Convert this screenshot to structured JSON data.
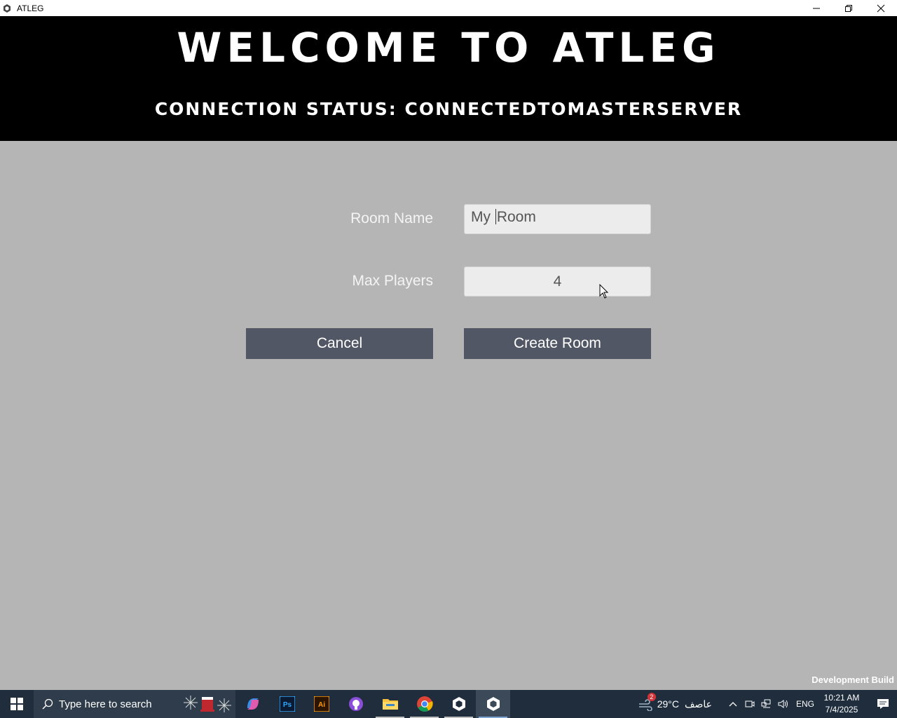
{
  "window": {
    "title": "ATLEG",
    "app_icon": "unity-icon",
    "controls": [
      "minimize-icon",
      "restore-icon",
      "close-icon"
    ]
  },
  "banner": {
    "welcome": "WELCOME TO ATLEG",
    "status": "CONNECTION STATUS: CONNECTEDTOMASTERSERVER"
  },
  "form": {
    "room_name_label": "Room Name",
    "room_name_before_caret": "My ",
    "room_name_after_caret": "Room",
    "max_players_label": "Max Players",
    "max_players_value": "4",
    "cancel_label": "Cancel",
    "create_label": "Create Room"
  },
  "footer": {
    "dev_build": "Development Build"
  },
  "taskbar": {
    "search_placeholder": "Type here to search",
    "apps": [
      "copilot-icon",
      "photoshop-icon",
      "illustrator-icon",
      "github-desktop-icon",
      "file-explorer-icon",
      "chrome-icon",
      "unity-hub-icon",
      "unity-player-icon"
    ],
    "weather_badge": "2",
    "temperature": "29°C",
    "weather_text": "عاصف",
    "language": "ENG",
    "time": "10:21 AM",
    "date": "7/4/2025"
  },
  "colors": {
    "background": "#b5b5b5",
    "banner": "#000000",
    "button": "#515764",
    "field": "#ececec",
    "taskbar": "#1f2d3d"
  }
}
